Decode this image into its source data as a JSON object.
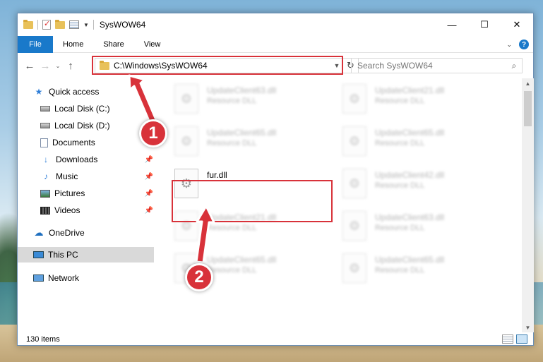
{
  "window": {
    "title": "SysWOW64",
    "controls": {
      "minimize": "—",
      "maximize": "☐",
      "close": "✕"
    }
  },
  "ribbon": {
    "file": "File",
    "tabs": [
      "Home",
      "Share",
      "View"
    ],
    "help": "?"
  },
  "nav": {
    "back": "←",
    "forward": "→",
    "recent": "⌄",
    "up": "↑",
    "address": "C:\\Windows\\SysWOW64",
    "refresh": "↻",
    "search_placeholder": "Search SysWOW64"
  },
  "sidebar": {
    "items": [
      {
        "label": "Quick access",
        "icon": "star-icon",
        "pinned": false
      },
      {
        "label": "Local Disk (C:)",
        "icon": "drive-icon",
        "pinned": true
      },
      {
        "label": "Local Disk (D:)",
        "icon": "drive-icon",
        "pinned": true
      },
      {
        "label": "Documents",
        "icon": "documents-icon",
        "pinned": true
      },
      {
        "label": "Downloads",
        "icon": "downloads-icon",
        "pinned": true
      },
      {
        "label": "Music",
        "icon": "music-icon",
        "pinned": true
      },
      {
        "label": "Pictures",
        "icon": "pictures-icon",
        "pinned": true
      },
      {
        "label": "Videos",
        "icon": "videos-icon",
        "pinned": true
      },
      {
        "label": "OneDrive",
        "icon": "onedrive-icon",
        "pinned": false
      },
      {
        "label": "This PC",
        "icon": "this-pc-icon",
        "pinned": false,
        "selected": true
      },
      {
        "label": "Network",
        "icon": "network-icon",
        "pinned": false
      }
    ]
  },
  "files": [
    {
      "name": "UpdateClient63.dll",
      "type": "Resource DLL",
      "blurred": true
    },
    {
      "name": "UpdateClient21.dll",
      "type": "Resource DLL",
      "blurred": true
    },
    {
      "name": "UpdateClient65.dll",
      "type": "Resource DLL",
      "blurred": true
    },
    {
      "name": "UpdateClient65.dll",
      "type": "Resource DLL",
      "blurred": true
    },
    {
      "name": "fur.dll",
      "type": "",
      "blurred": false
    },
    {
      "name": "UpdateClient42.dll",
      "type": "Resource DLL",
      "blurred": true
    },
    {
      "name": "UpdateClient21.dll",
      "type": "Resource DLL",
      "blurred": true
    },
    {
      "name": "UpdateClient63.dll",
      "type": "Resource DLL",
      "blurred": true
    },
    {
      "name": "UpdateClient65.dll",
      "type": "Resource DLL",
      "blurred": true
    },
    {
      "name": "UpdateClient65.dll",
      "type": "Resource DLL",
      "blurred": true
    }
  ],
  "status": {
    "count": "130 items"
  },
  "annotations": {
    "step1": "1",
    "step2": "2"
  },
  "colors": {
    "accent": "#1979ca",
    "highlight": "#d8323a"
  }
}
